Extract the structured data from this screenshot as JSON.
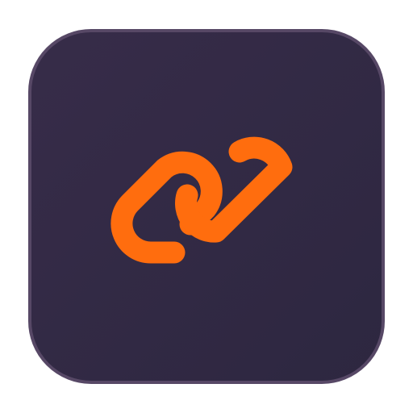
{
  "app_icon": {
    "symbol": "link-icon",
    "colors": {
      "background": "#352b47",
      "border": "#574866",
      "accent": "#ff6d0e"
    }
  }
}
